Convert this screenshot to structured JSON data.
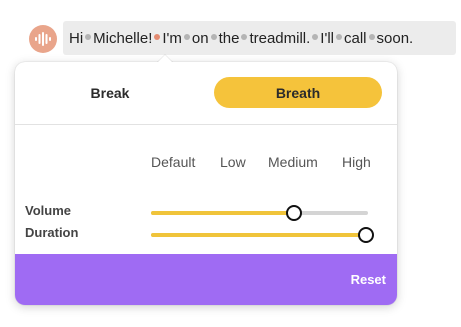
{
  "icons": {
    "avatar": "sound-wave-icon"
  },
  "sentence": {
    "words": [
      "Hi",
      "Michelle!",
      "I'm",
      "on",
      "the",
      "treadmill.",
      "I'll",
      "call",
      "soon."
    ],
    "accent_gap_index": 1
  },
  "tabs": [
    {
      "label": "Break",
      "selected": false
    },
    {
      "label": "Breath",
      "selected": true
    }
  ],
  "levels": [
    "Default",
    "Low",
    "Medium",
    "High"
  ],
  "sliders": {
    "volume": {
      "label": "Volume",
      "value_fraction": 0.66
    },
    "duration": {
      "label": "Duration",
      "value_fraction": 0.99
    }
  },
  "footer": {
    "reset_label": "Reset"
  },
  "colors": {
    "accent_yellow": "#f5c33b",
    "footer_purple": "#9f6bf3",
    "avatar_orange": "#e9a58b",
    "break_dot": "#b4b4b4",
    "break_dot_accent": "#e38b71"
  }
}
